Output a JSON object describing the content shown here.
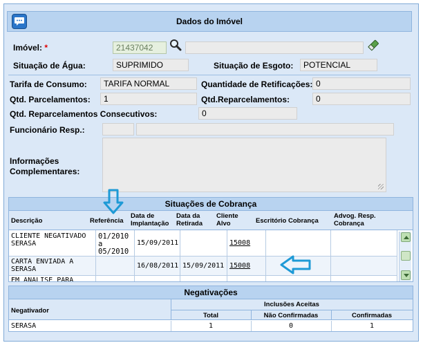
{
  "header": {
    "title": "Dados do Imóvel"
  },
  "imovel": {
    "label": "Imóvel:",
    "required_mark": "*",
    "matricula": "21437042",
    "endereco": ""
  },
  "agua": {
    "label": "Situação de Água:",
    "value": "SUPRIMIDO"
  },
  "esgoto": {
    "label": "Situação de Esgoto:",
    "value": "POTENCIAL"
  },
  "tarifa": {
    "label": "Tarifa de Consumo:",
    "value": "TARIFA NORMAL"
  },
  "retificacoes": {
    "label": "Quantidade de Retificações:",
    "value": "0"
  },
  "parcelamentos": {
    "label": "Qtd. Parcelamentos:",
    "value": "1"
  },
  "reparcelamentos": {
    "label": "Qtd.Reparcelamentos:",
    "value": "0"
  },
  "reparc_consecutivos": {
    "label": "Qtd. Reparcelamentos Consecutivos:",
    "value": "0"
  },
  "funcionario": {
    "label": "Funcionário Resp.:",
    "code": "",
    "name": ""
  },
  "informacoes": {
    "label_line1": "Informações",
    "label_line2": "Complementares:",
    "value": ""
  },
  "cobranca": {
    "title": "Situações de Cobrança",
    "columns": {
      "descricao": "Descrição",
      "referencia": "Referência",
      "data_implantacao": "Data de Implantação",
      "data_retirada": "Data da Retirada",
      "cliente_alvo": "Cliente Alvo",
      "escritorio": "Escritório Cobrança",
      "advog": "Advog. Resp. Cobrança"
    },
    "rows": [
      {
        "descricao": "CLIENTE NEGATIVADO SERASA",
        "referencia": "01/2010 a 05/2010",
        "data_implantacao": "15/09/2011",
        "data_retirada": "",
        "cliente_alvo": "15008",
        "escritorio": "",
        "advog": ""
      },
      {
        "descricao": "CARTA ENVIADA A SERASA",
        "referencia": "",
        "data_implantacao": "16/08/2011",
        "data_retirada": "15/09/2011",
        "cliente_alvo": "15008",
        "escritorio": "",
        "advog": ""
      },
      {
        "descricao": "EM ANALISE PARA",
        "referencia": "",
        "data_implantacao": "",
        "data_retirada": "",
        "cliente_alvo": "",
        "escritorio": "",
        "advog": ""
      }
    ]
  },
  "negativacoes": {
    "title": "Negativações",
    "columns": {
      "negativador": "Negativador",
      "inclusoes": "Inclusões Aceitas",
      "total": "Total",
      "nao_confirmadas": "Não Confirmadas",
      "confirmadas": "Confirmadas"
    },
    "rows": [
      {
        "negativador": "SERASA",
        "total": "1",
        "nao_confirmadas": "0",
        "confirmadas": "1"
      }
    ]
  },
  "colors": {
    "panel": "#dbe8f7",
    "header": "#b8d3f0",
    "annotation_arrow": "#1e9ad6"
  }
}
